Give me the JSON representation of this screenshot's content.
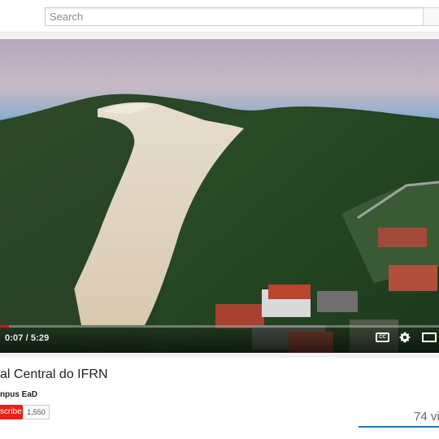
{
  "search": {
    "placeholder": "Search"
  },
  "player": {
    "time": "0:07 / 5:29",
    "progress": 0.021,
    "cc_label": "CC"
  },
  "video": {
    "title": "al Central do IFRN",
    "channel": "npus EaD",
    "subscribe_label": "scribe",
    "subscriber_count": "1,550",
    "views": "74 vi"
  },
  "icons": [
    "search-icon",
    "closed-captions-icon",
    "gear-icon",
    "theater-mode-icon"
  ],
  "colors": {
    "accent": "#cc181e",
    "subscribe": "#e62117",
    "sentiment": "#167ac6"
  }
}
